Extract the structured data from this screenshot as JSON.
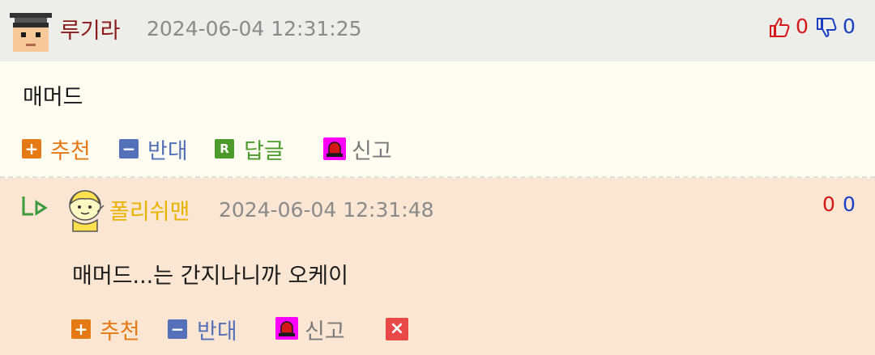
{
  "comments": [
    {
      "nickname": "루기라",
      "date": "2024-06-04 12:31:25",
      "text": "매머드",
      "likes": "0",
      "dislikes": "0"
    },
    {
      "nickname": "폴리쉬맨",
      "date": "2024-06-04 12:31:48",
      "text": "매머드...는 간지나니까 오케이",
      "likes": "0",
      "dislikes": "0"
    }
  ],
  "actions": {
    "recommend": "추천",
    "oppose": "반대",
    "reply": "답글",
    "report": "신고"
  },
  "icon_letters": {
    "plus": "+",
    "minus": "−",
    "reply": "R",
    "delete": "×"
  },
  "colors": {
    "recommend": "#e57a15",
    "oppose": "#5470b8",
    "reply": "#4c9a2a",
    "report": "#ff00ff",
    "delete": "#e84848"
  }
}
